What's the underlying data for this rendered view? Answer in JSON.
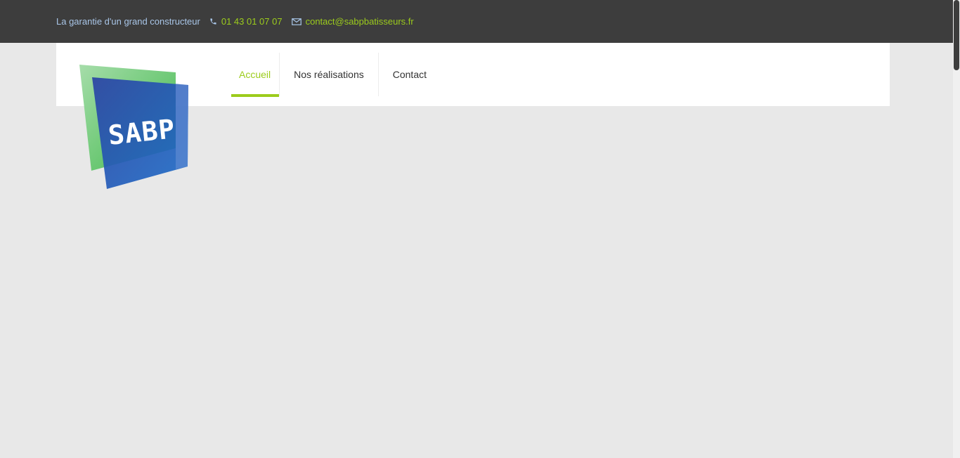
{
  "topbar": {
    "tagline": "La garantie d'un grand constructeur",
    "phone": "01 43 01 07 07",
    "email": "contact@sabpbatisseurs.fr"
  },
  "logo": {
    "text": "SABP",
    "colors": {
      "green": "#4fc45a",
      "blue": "#2552b8"
    }
  },
  "nav": {
    "items": [
      {
        "label": "Accueil",
        "active": true
      },
      {
        "label": "Nos réalisations",
        "active": false
      },
      {
        "label": "Contact",
        "active": false
      }
    ]
  },
  "colors": {
    "accent": "#9ccc1c",
    "topbar_bg": "#3d3d3d",
    "page_bg": "#e8e8e8",
    "tagline": "#a9c6e8"
  },
  "icons": [
    "phone-icon",
    "mail-icon"
  ]
}
